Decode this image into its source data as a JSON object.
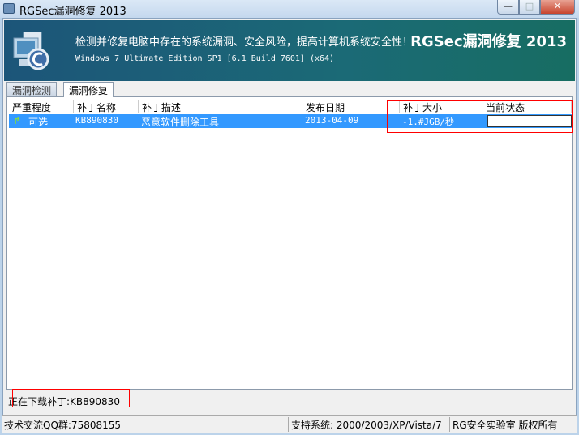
{
  "window": {
    "title": "RGSec漏洞修复 2013",
    "minimize": "—",
    "maximize": "□",
    "close": "✕"
  },
  "banner": {
    "slogan": "检测并修复电脑中存在的系统漏洞、安全风险，提高计算机系统安全性！",
    "os_info": "Windows 7 Ultimate Edition SP1 [6.1 Build 7601] (x64)",
    "app_title": "RGSec漏洞修复 2013"
  },
  "tabs": [
    {
      "label": "漏洞检测"
    },
    {
      "label": "漏洞修复"
    }
  ],
  "table": {
    "columns": [
      "严重程度",
      "补丁名称",
      "补丁描述",
      "发布日期",
      "补丁大小",
      "当前状态"
    ],
    "rows": [
      {
        "severity": "可选",
        "name": "KB890830",
        "description": "恶意软件删除工具",
        "date": "2013-04-09",
        "size": "-1.#JGB/秒",
        "status": ""
      }
    ]
  },
  "download_status": "正在下载补丁:KB890830",
  "statusbar": {
    "qq": "技术交流QQ群:75808155",
    "systems": "支持系统: 2000/2003/XP/Vista/7",
    "copyright": "RG安全实验室 版权所有"
  }
}
